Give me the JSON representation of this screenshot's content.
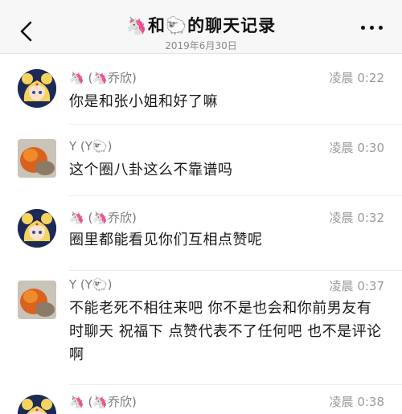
{
  "header": {
    "title": "🦄和🐑的聊天记录",
    "subtitle": "2019年6月30日",
    "back_icon": "chevron-left-icon",
    "more_icon": "more-dots-icon"
  },
  "messages": [
    {
      "sender": "🦄 (🦄乔欣)",
      "time": "凌晨 0:22",
      "text": "你是和张小姐和好了嘛",
      "avatar": "sailor-moon-avatar"
    },
    {
      "sender": "Y (Y🐑)",
      "time": "凌晨 0:30",
      "text": "这个圈八卦这么不靠谱吗",
      "avatar": "orange-photo-avatar"
    },
    {
      "sender": "🦄 (🦄乔欣)",
      "time": "凌晨 0:32",
      "text": "圈里都能看见你们互相点赞呢",
      "avatar": "sailor-moon-avatar"
    },
    {
      "sender": "Y (Y🐑)",
      "time": "凌晨 0:37",
      "text": "不能老死不相往来吧 你不是也会和你前男友有时聊天 祝福下 点赞代表不了任何吧 也不是评论啊",
      "avatar": "orange-photo-avatar"
    },
    {
      "sender": "🦄 (🦄乔欣)",
      "time": "凌晨 0:38",
      "text": "",
      "avatar": "sailor-moon-avatar"
    }
  ]
}
